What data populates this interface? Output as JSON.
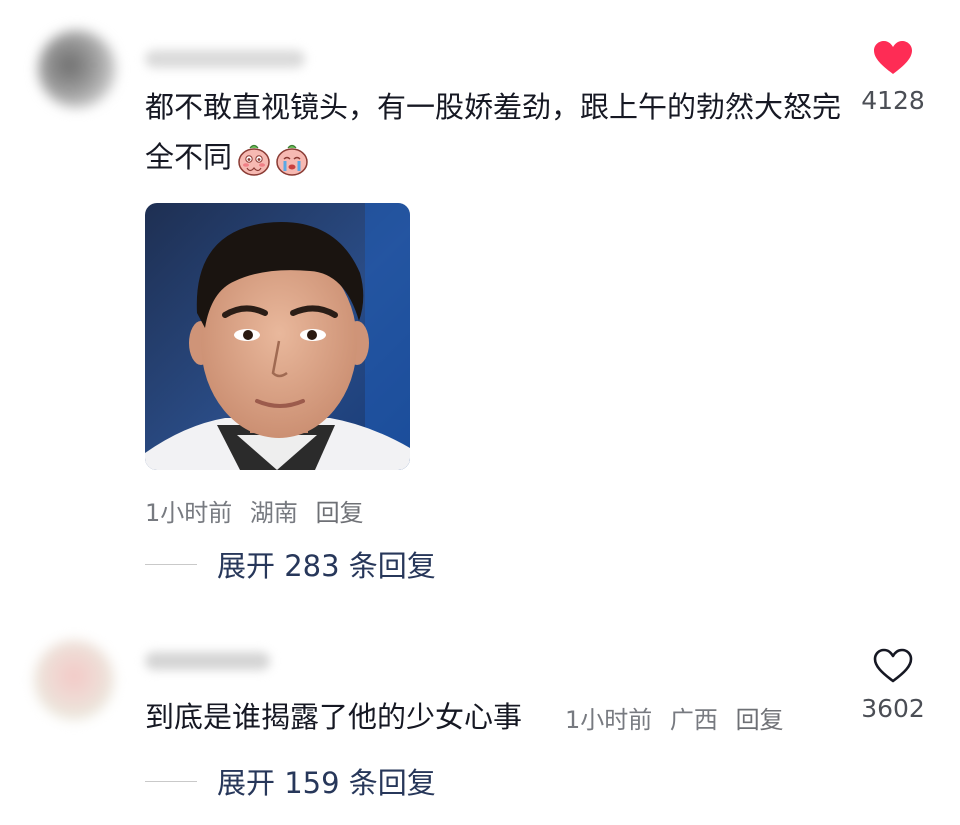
{
  "comments": [
    {
      "text": "都不敢直视镜头，有一股娇羞劲，跟上午的勃然大怒完全不同",
      "emojis": [
        "blushing-emoji",
        "crying-emoji"
      ],
      "time": "1小时前",
      "location": "湖南",
      "reply_label": "回复",
      "expand_label": "展开 283 条回复",
      "likes": "4128",
      "liked": true,
      "like_color": "#fe2c55"
    },
    {
      "text": "到底是谁揭露了他的少女心事",
      "time": "1小时前",
      "location": "广西",
      "reply_label": "回复",
      "expand_label": "展开 159 条回复",
      "likes": "3602",
      "liked": false,
      "like_color": "#161823"
    }
  ]
}
